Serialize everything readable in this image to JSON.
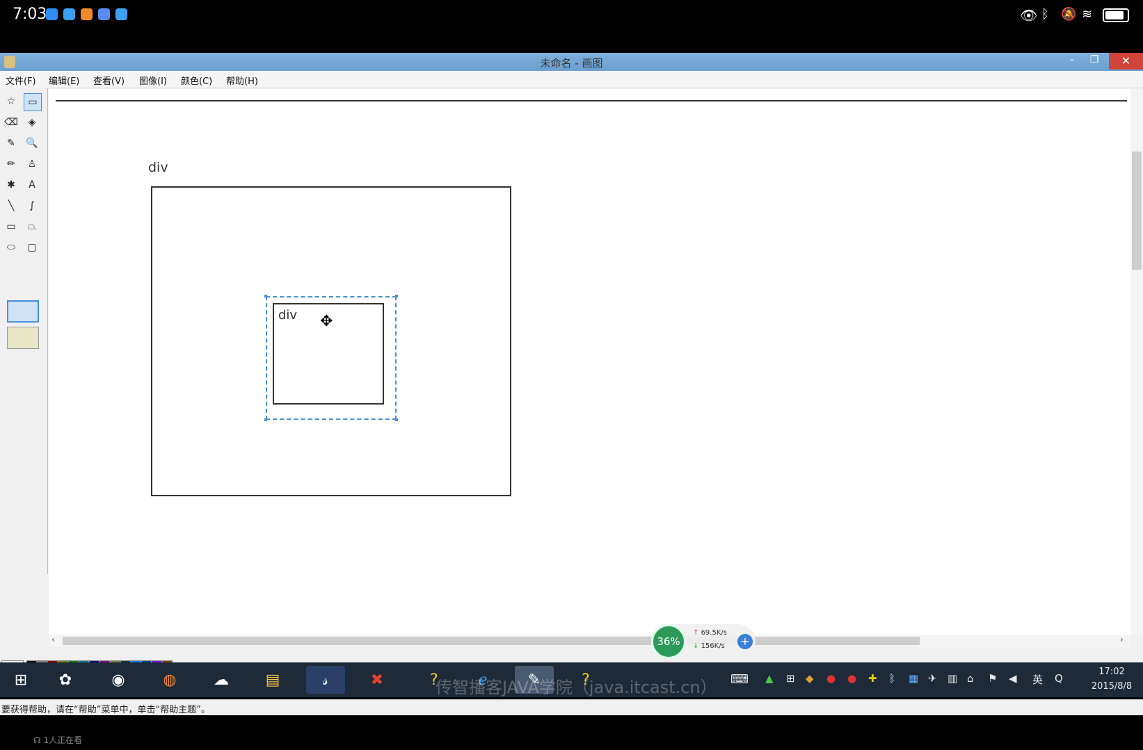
{
  "phone_status": {
    "time": "7:03"
  },
  "window": {
    "title": "未命名 - 画图"
  },
  "menu": [
    "文件(F)",
    "编辑(E)",
    "查看(V)",
    "图像(I)",
    "颜色(C)",
    "帮助(H)"
  ],
  "tools": [
    "free-select-icon",
    "rect-select-icon",
    "eraser-icon",
    "fill-icon",
    "color-picker-icon",
    "magnifier-icon",
    "pencil-icon",
    "brush-icon",
    "airbrush-icon",
    "text-icon",
    "line-icon",
    "curve-icon",
    "rectangle-icon",
    "polygon-icon",
    "ellipse-icon",
    "rounded-rect-icon"
  ],
  "tool_glyphs": [
    "☆",
    "▭",
    "⌫",
    "◈",
    "✎",
    "🔍",
    "✏",
    "♙",
    "✱",
    "A",
    "╲",
    "∫",
    "▭",
    "⏢",
    "⬭",
    "▢"
  ],
  "canvas": {
    "outer_label": "div",
    "inner_label": "div",
    "move_cursor": "✥"
  },
  "palette": {
    "top_colors": [
      "#000000",
      "#808080",
      "#800000",
      "#808000",
      "#008000",
      "#008080",
      "#000080",
      "#800080",
      "#808040",
      "#004040",
      "#0080ff",
      "#004080",
      "#8000ff",
      "#804000"
    ],
    "bottom_colors": [
      "#ffffff",
      "#c0c0c0",
      "#ff0000",
      "#ffff00",
      "#00ff00",
      "#00ffff",
      "#0000ff",
      "#ff00ff",
      "#ffff80",
      "#00ff80",
      "#80ffff",
      "#8080ff",
      "#ff0080",
      "#ff8040"
    ]
  },
  "status_text": "要获得帮助，请在“帮助”菜单中，单击“帮助主题”。",
  "net_monitor": {
    "percent": "36%",
    "up": "69.5K/s",
    "down": "156K/s"
  },
  "watermark": "传智播客JAVA学院（java.itcast.cn）",
  "tray": {
    "ime": "英",
    "time": "17:02",
    "date": "2015/8/8"
  },
  "viewer_count": "1人正在看"
}
